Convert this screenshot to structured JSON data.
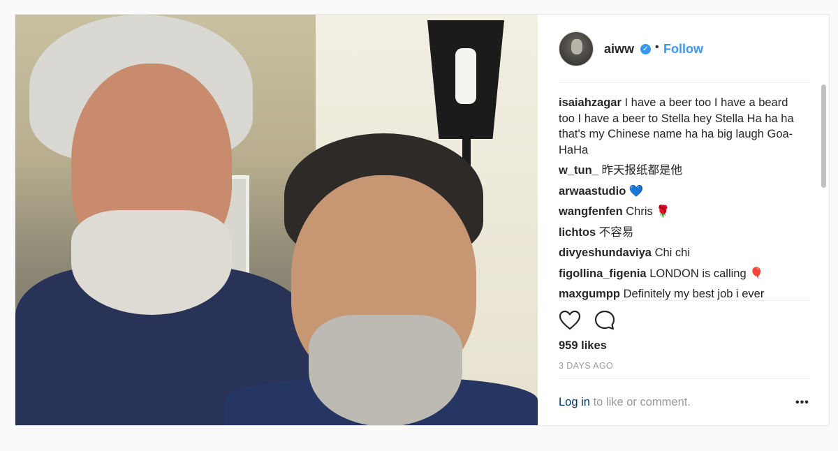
{
  "post": {
    "username": "aiww",
    "verified_symbol": "✓",
    "dot": "•",
    "follow_label": "Follow",
    "comments": [
      {
        "user": "isaiahzagar",
        "text": "I have a beer too I have a beard too I have a beer to Stella hey Stella Ha ha ha that's my Chinese name ha ha big laugh Goa-HaHa"
      },
      {
        "user": "w_tun_",
        "text": "昨天报纸都是他"
      },
      {
        "user": "arwaastudio",
        "text": "💙"
      },
      {
        "user": "wangfenfen",
        "text": "Chris 🌹"
      },
      {
        "user": "lichtos",
        "text": "不容易"
      },
      {
        "user": "divyeshundaviya",
        "text": "Chi chi"
      },
      {
        "user": "figollina_figenia",
        "text": "LONDON is calling 🎈"
      },
      {
        "user": "maxgumpp",
        "text": "Definitely my best job i ever"
      }
    ],
    "likes": "959 likes",
    "timestamp": "3 DAYS AGO",
    "login_link": "Log in",
    "login_suffix": "to like or comment.",
    "more_label": "•••",
    "icons": {
      "like": "heart-icon",
      "comment": "comment-bubble-icon",
      "verified": "verified-badge-icon"
    },
    "colors": {
      "accent": "#3897f0",
      "text": "#262626",
      "muted": "#999999",
      "link": "#003569"
    }
  }
}
